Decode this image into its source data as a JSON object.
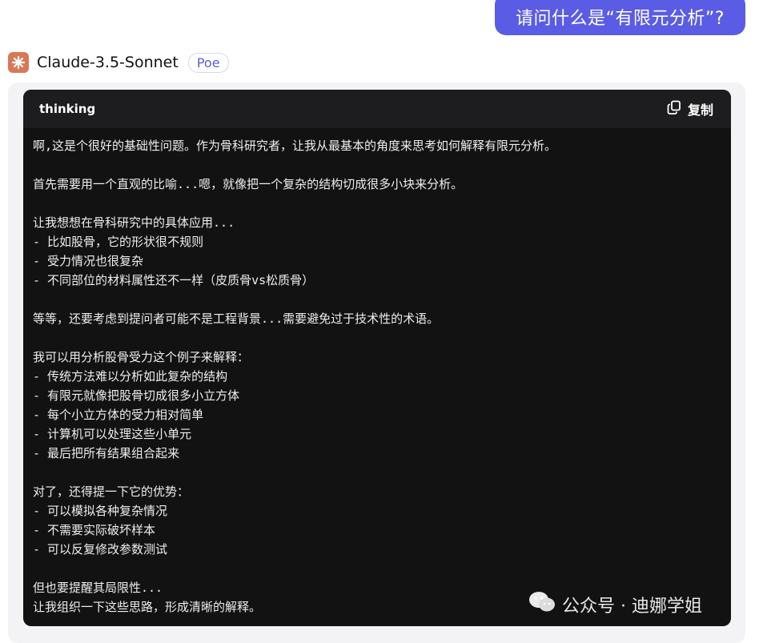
{
  "user_message": "请问什么是“有限元分析”?",
  "bot": {
    "name": "Claude-3.5-Sonnet",
    "badge": "Poe",
    "avatar_color": "#d97757"
  },
  "code_block": {
    "language": "thinking",
    "copy_label": "复制",
    "lines": [
      "啊,这是个很好的基础性问题。作为骨科研究者，让我从最基本的角度来思考如何解释有限元分析。",
      "",
      "首先需要用一个直观的比喻...嗯，就像把一个复杂的结构切成很多小块来分析。",
      "",
      "让我想想在骨科研究中的具体应用...",
      "- 比如股骨，它的形状很不规则",
      "- 受力情况也很复杂",
      "- 不同部位的材料属性还不一样（皮质骨vs松质骨）",
      "",
      "等等，还要考虑到提问者可能不是工程背景...需要避免过于技术性的术语。",
      "",
      "我可以用分析股骨受力这个例子来解释：",
      "- 传统方法难以分析如此复杂的结构",
      "- 有限元就像把股骨切成很多小立方体",
      "- 每个小立方体的受力相对简单",
      "- 计算机可以处理这些小单元",
      "- 最后把所有结果组合起来",
      "",
      "对了，还得提一下它的优势：",
      "- 可以模拟各种复杂情况",
      "- 不需要实际破坏样本",
      "- 可以反复修改参数测试",
      "",
      "但也要提醒其局限性...",
      "让我组织一下这些思路，形成清晰的解释。"
    ]
  },
  "watermark": "公众号 · 迪娜学姐",
  "colors": {
    "accent": "#5b5ce6",
    "code_bg": "#121212",
    "code_header_bg": "#1d1d1f"
  }
}
